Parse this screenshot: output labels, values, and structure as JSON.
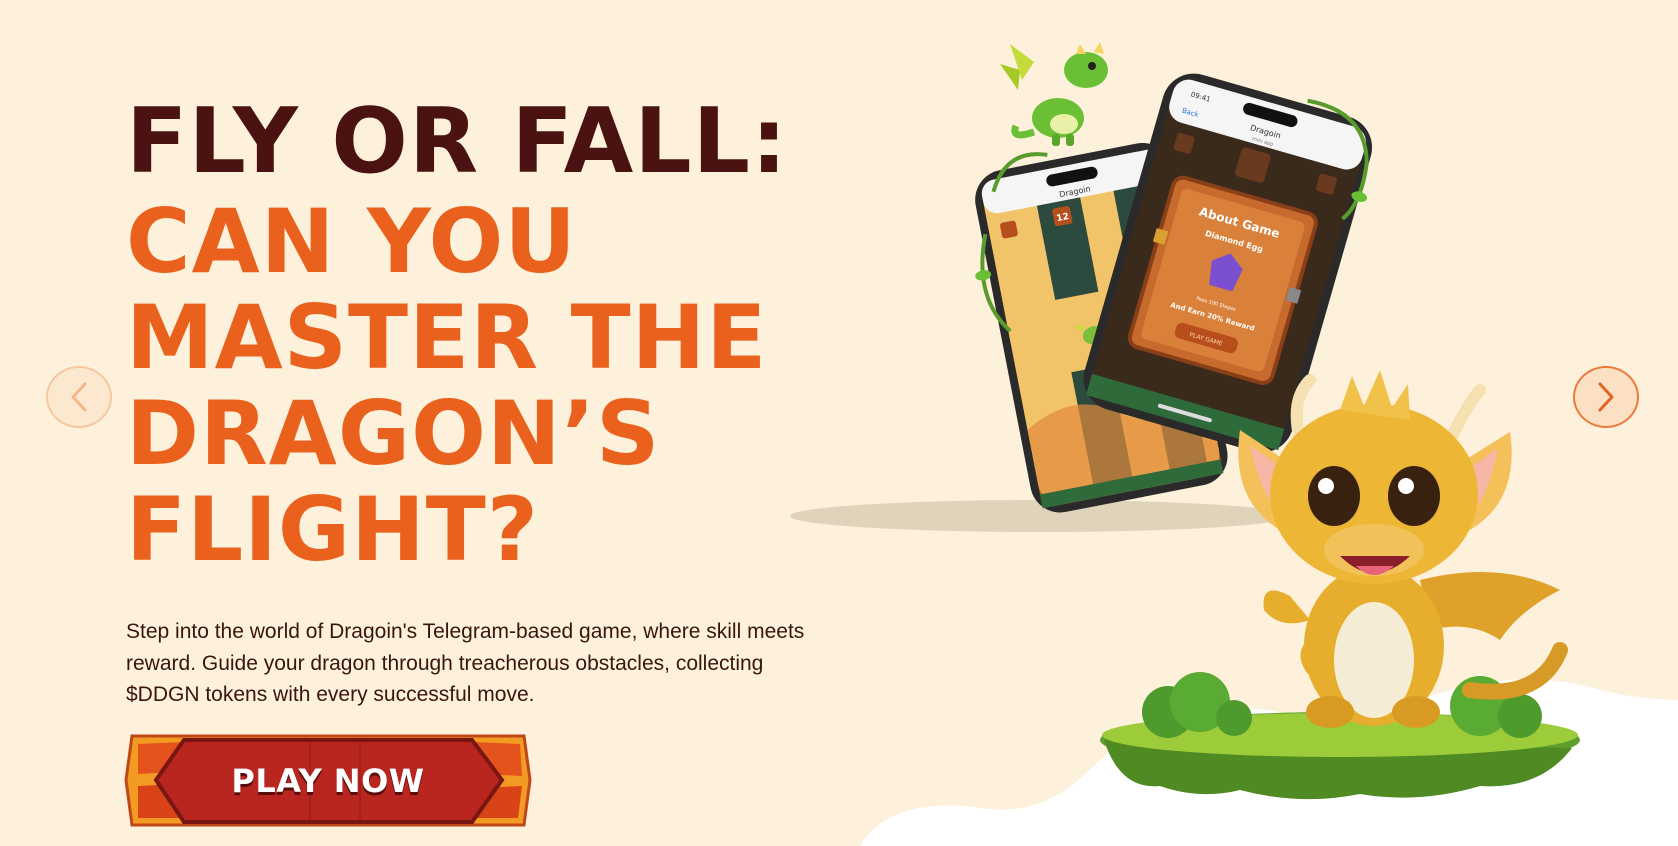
{
  "hero": {
    "title_line1": "FLY OR FALL:",
    "title_lines": [
      "CAN YOU",
      "MASTER THE",
      "DRAGON’S",
      "FLIGHT?"
    ],
    "description": "Step into the world of Dragoin's Telegram-based game, where skill meets reward. Guide your dragon through treacherous obstacles, collecting $DDGN tokens with every successful move.",
    "play_button_label": "PLAY NOW"
  },
  "carousel": {
    "prev_icon": "chevron-left-icon",
    "next_icon": "chevron-right-icon"
  },
  "phone_left": {
    "app_title": "Dragoin",
    "score": "12"
  },
  "phone_right": {
    "back_label": "Back",
    "app_title": "Dragoin",
    "app_subtitle": "mini app",
    "status_time": "09:41",
    "modal_title": "About Game",
    "modal_subtitle": "Diamond Egg",
    "modal_line1": "Pass 100 Stages",
    "modal_line2": "And Earn 20% Reward",
    "modal_button": "PLAY GAME"
  },
  "colors": {
    "background": "#fdf1dc",
    "title_dark": "#4a1210",
    "title_orange": "#ea611d",
    "button_red": "#b8261f",
    "button_orange": "#f39a22"
  }
}
